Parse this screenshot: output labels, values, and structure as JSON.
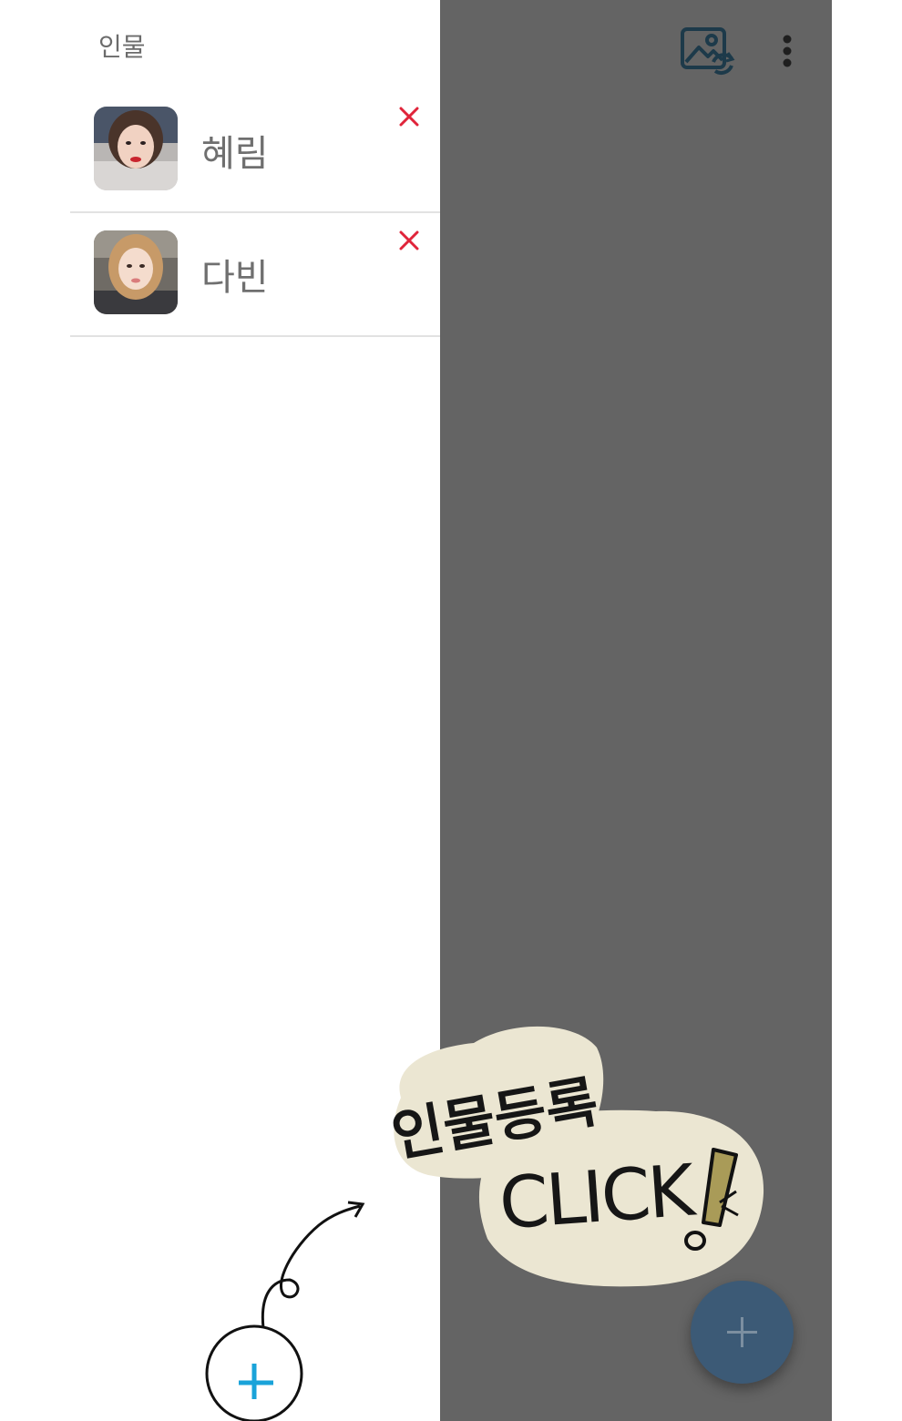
{
  "drawer": {
    "title": "인물",
    "people": [
      {
        "name": "혜림"
      },
      {
        "name": "다빈"
      }
    ]
  },
  "toolbar": {
    "icons": [
      "photo-sync-icon",
      "more-vert-icon"
    ]
  },
  "fab": {
    "icon": "plus-icon"
  },
  "annotation": {
    "line1": "인물등록",
    "line2": "CLICK",
    "mark": "!"
  },
  "colors": {
    "scrim": "#646464",
    "fab": "#3c5a76",
    "delete": "#e0243a",
    "accent_plus": "#1aa3d9",
    "bubble": "#ebe6d2"
  }
}
